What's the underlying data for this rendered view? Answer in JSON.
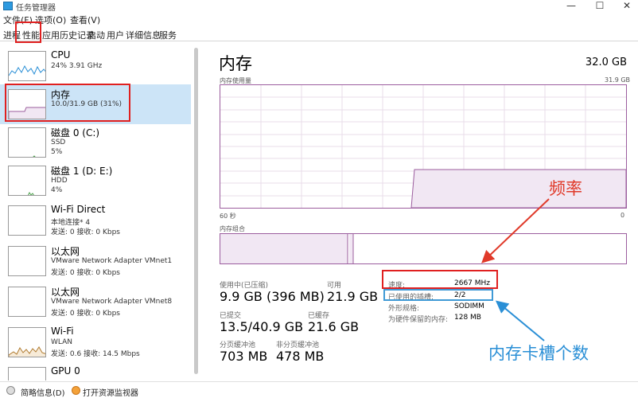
{
  "window": {
    "title": "任务管理器",
    "min_glyph": "—",
    "max_glyph": "☐",
    "close_glyph": "✕"
  },
  "menu": [
    "文件(F)",
    "选项(O)",
    "查看(V)"
  ],
  "tabs": [
    "进程",
    "性能",
    "应用历史记录",
    "启动",
    "用户",
    "详细信息",
    "服务"
  ],
  "sidebar": {
    "items": [
      {
        "title": "CPU",
        "sub1": "24%  3.91 GHz",
        "sub2": ""
      },
      {
        "title": "内存",
        "sub1": "10.0/31.9 GB (31%)",
        "sub2": ""
      },
      {
        "title": "磁盘 0 (C:)",
        "sub1": "SSD",
        "sub2": "5%"
      },
      {
        "title": "磁盘 1 (D: E:)",
        "sub1": "HDD",
        "sub2": "4%"
      },
      {
        "title": "Wi-Fi Direct",
        "sub1": "本地连接* 4",
        "sub2": "发送: 0 接收: 0 Kbps"
      },
      {
        "title": "以太网",
        "sub1": "VMware Network Adapter VMnet1",
        "sub2": "发送: 0 接收: 0 Kbps"
      },
      {
        "title": "以太网",
        "sub1": "VMware Network Adapter VMnet8",
        "sub2": "发送: 0 接收: 0 Kbps"
      },
      {
        "title": "Wi-Fi",
        "sub1": "WLAN",
        "sub2": "发送: 0.6 接收: 14.5 Mbps"
      },
      {
        "title": "GPU 0",
        "sub1": "",
        "sub2": ""
      }
    ]
  },
  "main": {
    "title": "内存",
    "total": "32.0 GB",
    "usage_label": "内存使用量",
    "usage_max": "31.9 GB",
    "time_left": "60 秒",
    "time_right": "0",
    "composition_label": "内存组合",
    "usage_fraction": 0.31,
    "stats": {
      "in_use_label": "使用中(已压缩)",
      "in_use_value": "9.9 GB (396 MB)",
      "available_label": "可用",
      "available_value": "21.9 GB",
      "committed_label": "已提交",
      "committed_value": "13.5/40.9 GB",
      "cached_label": "已缓存",
      "cached_value": "21.6 GB",
      "paged_label": "分页缓冲池",
      "paged_value": "703 MB",
      "nonpaged_label": "非分页缓冲池",
      "nonpaged_value": "478 MB"
    },
    "specs": [
      {
        "key": "速度:",
        "value": "2667 MHz"
      },
      {
        "key": "已使用的插槽:",
        "value": "2/2"
      },
      {
        "key": "外形规格:",
        "value": "SODIMM"
      },
      {
        "key": "为硬件保留的内存:",
        "value": "128 MB"
      }
    ]
  },
  "annotations": {
    "frequency": "频率",
    "slots": "内存卡槽个数",
    "red_color": "#e03a2a",
    "blue_color": "#2a8fd6"
  },
  "footer": {
    "summary": "简略信息(D)",
    "resource_monitor": "打开资源监视器"
  },
  "colors": {
    "accent_memory": "#9b5d9e",
    "memory_fill": "#f1e7f3",
    "selected_bg": "#cce4f7",
    "highlight_red": "#e02020",
    "highlight_blue": "#3f9ad6"
  }
}
